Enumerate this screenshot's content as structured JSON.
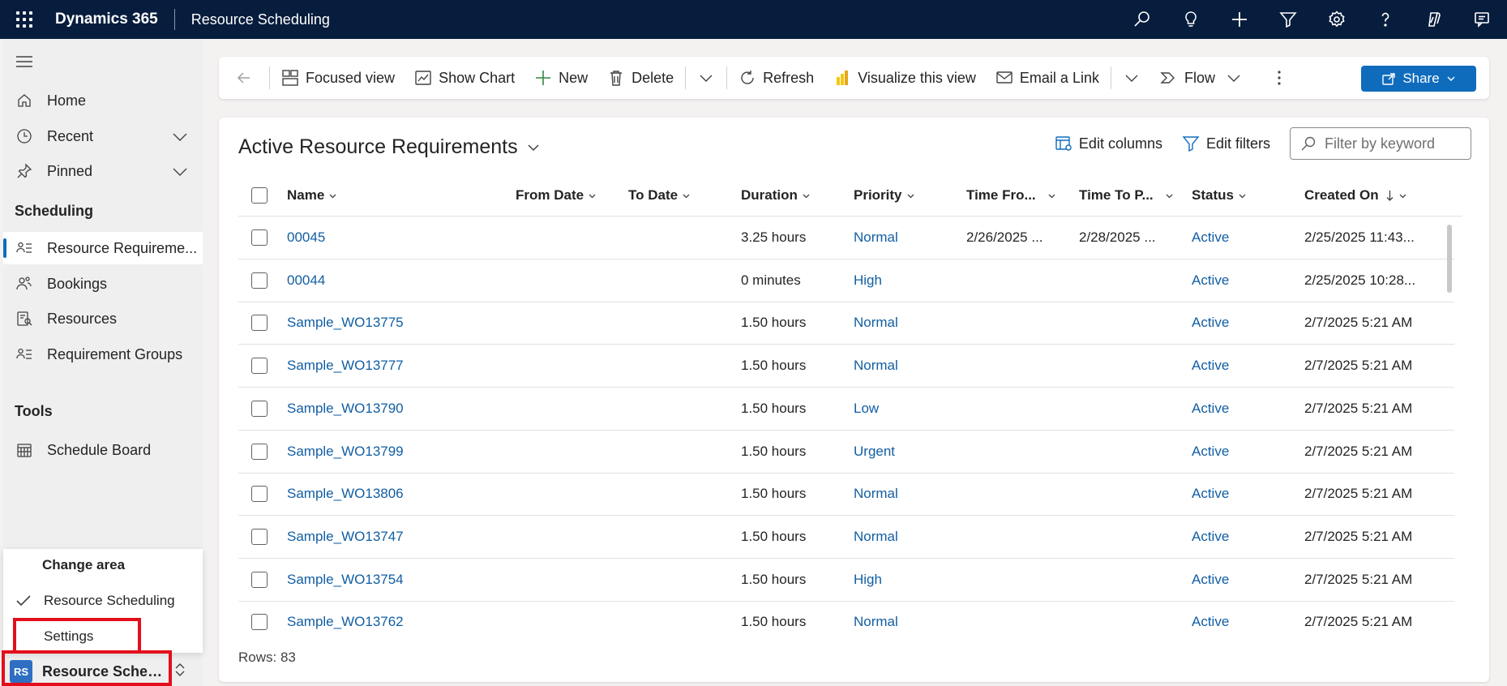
{
  "topbar": {
    "app_title": "Dynamics 365",
    "area_title": "Resource Scheduling",
    "icons": [
      "search-icon",
      "lightbulb-icon",
      "plus-icon",
      "filter-icon",
      "gear-icon",
      "help-icon",
      "copilot-icon",
      "chat-icon"
    ]
  },
  "leftnav": {
    "home": "Home",
    "recent": "Recent",
    "pinned": "Pinned",
    "scheduling_heading": "Scheduling",
    "items": [
      "Resource Requireme...",
      "Bookings",
      "Resources",
      "Requirement Groups"
    ],
    "tools_heading": "Tools",
    "schedule_board": "Schedule Board"
  },
  "change_area": {
    "title": "Change area",
    "current": "Resource Scheduling",
    "settings": "Settings"
  },
  "area_switcher": {
    "badge": "RS",
    "label": "Resource Schedul..."
  },
  "commandbar": {
    "focused_view": "Focused view",
    "show_chart": "Show Chart",
    "new": "New",
    "delete": "Delete",
    "refresh": "Refresh",
    "visualize": "Visualize this view",
    "email_link": "Email a Link",
    "flow": "Flow",
    "share": "Share"
  },
  "view": {
    "title": "Active Resource Requirements",
    "edit_columns": "Edit columns",
    "edit_filters": "Edit filters",
    "filter_placeholder": "Filter by keyword",
    "rows_label": "Rows: 83"
  },
  "columns": [
    "Name",
    "From Date",
    "To Date",
    "Duration",
    "Priority",
    "Time Fro...",
    "Time To P...",
    "Status",
    "Created On"
  ],
  "rows": [
    {
      "name": "00045",
      "from": "",
      "to": "",
      "duration": "3.25 hours",
      "priority": "Normal",
      "time_from": "2/26/2025 ...",
      "time_to": "2/28/2025 ...",
      "status": "Active",
      "created": "2/25/2025 11:43..."
    },
    {
      "name": "00044",
      "from": "",
      "to": "",
      "duration": "0 minutes",
      "priority": "High",
      "time_from": "",
      "time_to": "",
      "status": "Active",
      "created": "2/25/2025 10:28..."
    },
    {
      "name": "Sample_WO13775",
      "from": "",
      "to": "",
      "duration": "1.50 hours",
      "priority": "Normal",
      "time_from": "",
      "time_to": "",
      "status": "Active",
      "created": "2/7/2025 5:21 AM"
    },
    {
      "name": "Sample_WO13777",
      "from": "",
      "to": "",
      "duration": "1.50 hours",
      "priority": "Normal",
      "time_from": "",
      "time_to": "",
      "status": "Active",
      "created": "2/7/2025 5:21 AM"
    },
    {
      "name": "Sample_WO13790",
      "from": "",
      "to": "",
      "duration": "1.50 hours",
      "priority": "Low",
      "time_from": "",
      "time_to": "",
      "status": "Active",
      "created": "2/7/2025 5:21 AM"
    },
    {
      "name": "Sample_WO13799",
      "from": "",
      "to": "",
      "duration": "1.50 hours",
      "priority": "Urgent",
      "time_from": "",
      "time_to": "",
      "status": "Active",
      "created": "2/7/2025 5:21 AM"
    },
    {
      "name": "Sample_WO13806",
      "from": "",
      "to": "",
      "duration": "1.50 hours",
      "priority": "Normal",
      "time_from": "",
      "time_to": "",
      "status": "Active",
      "created": "2/7/2025 5:21 AM"
    },
    {
      "name": "Sample_WO13747",
      "from": "",
      "to": "",
      "duration": "1.50 hours",
      "priority": "Normal",
      "time_from": "",
      "time_to": "",
      "status": "Active",
      "created": "2/7/2025 5:21 AM"
    },
    {
      "name": "Sample_WO13754",
      "from": "",
      "to": "",
      "duration": "1.50 hours",
      "priority": "High",
      "time_from": "",
      "time_to": "",
      "status": "Active",
      "created": "2/7/2025 5:21 AM"
    },
    {
      "name": "Sample_WO13762",
      "from": "",
      "to": "",
      "duration": "1.50 hours",
      "priority": "Normal",
      "time_from": "",
      "time_to": "",
      "status": "Active",
      "created": "2/7/2025 5:21 AM"
    }
  ],
  "colors": {
    "topbar": "#071d3d",
    "accent": "#0f6cbd",
    "link": "#115ea3",
    "highlight_box": "#e30e1b"
  }
}
